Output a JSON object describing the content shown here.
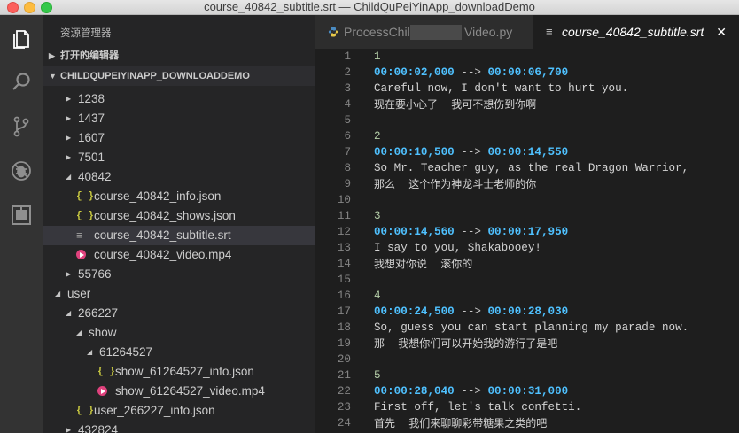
{
  "window": {
    "title": "course_40842_subtitle.srt — ChildQuPeiYinApp_downloadDemo"
  },
  "activity_bar": {
    "items": [
      "explorer",
      "search",
      "source-control",
      "debug",
      "extensions"
    ]
  },
  "sidebar": {
    "header": "资源管理器",
    "open_editors_label": "打开的编辑器",
    "project_label": "CHILDQUPEIYINAPP_DOWNLOADDEMO",
    "tree": [
      {
        "name": "1238",
        "type": "folder",
        "depth": 3,
        "expanded": false
      },
      {
        "name": "1437",
        "type": "folder",
        "depth": 3,
        "expanded": false
      },
      {
        "name": "1607",
        "type": "folder",
        "depth": 3,
        "expanded": false
      },
      {
        "name": "7501",
        "type": "folder",
        "depth": 3,
        "expanded": false
      },
      {
        "name": "40842",
        "type": "folder",
        "depth": 3,
        "expanded": true
      },
      {
        "name": "course_40842_info.json",
        "type": "json",
        "depth": 4
      },
      {
        "name": "course_40842_shows.json",
        "type": "json",
        "depth": 4
      },
      {
        "name": "course_40842_subtitle.srt",
        "type": "srt",
        "depth": 4,
        "selected": true
      },
      {
        "name": "course_40842_video.mp4",
        "type": "mp4",
        "depth": 4
      },
      {
        "name": "55766",
        "type": "folder",
        "depth": 3,
        "expanded": false
      },
      {
        "name": "user",
        "type": "folder",
        "depth": 2,
        "expanded": true
      },
      {
        "name": "266227",
        "type": "folder",
        "depth": 3,
        "expanded": true
      },
      {
        "name": "show",
        "type": "folder",
        "depth": 4,
        "expanded": true
      },
      {
        "name": "61264527",
        "type": "folder",
        "depth": 5,
        "expanded": true
      },
      {
        "name": "show_61264527_info.json",
        "type": "json",
        "depth": 6
      },
      {
        "name": "show_61264527_video.mp4",
        "type": "mp4",
        "depth": 6
      },
      {
        "name": "user_266227_info.json",
        "type": "json",
        "depth": 4
      },
      {
        "name": "432824",
        "type": "folder",
        "depth": 3,
        "expanded": false
      }
    ]
  },
  "tabs": [
    {
      "label_start": "ProcessChil",
      "label_end": "Video.py",
      "active": false
    },
    {
      "label": "course_40842_subtitle.srt",
      "active": true,
      "close": "✕"
    }
  ],
  "editor": {
    "lines": [
      {
        "n": "1",
        "kind": "num",
        "text": "1"
      },
      {
        "n": "2",
        "kind": "time",
        "start": "00:00:02,000",
        "arrow": " --> ",
        "end": "00:00:06,700"
      },
      {
        "n": "3",
        "kind": "plain",
        "text": "Careful now, I don't want to hurt you."
      },
      {
        "n": "4",
        "kind": "cn",
        "text": "现在要小心了    我可不想伤到你啊"
      },
      {
        "n": "5",
        "kind": "plain",
        "text": ""
      },
      {
        "n": "6",
        "kind": "num",
        "text": "2"
      },
      {
        "n": "7",
        "kind": "time",
        "start": "00:00:10,500",
        "arrow": " --> ",
        "end": "00:00:14,550"
      },
      {
        "n": "8",
        "kind": "plain",
        "text": "So Mr. Teacher guy, as the real Dragon Warrior,"
      },
      {
        "n": "9",
        "kind": "cn",
        "text": "那么    这个作为神龙斗士老师的你"
      },
      {
        "n": "10",
        "kind": "plain",
        "text": ""
      },
      {
        "n": "11",
        "kind": "num",
        "text": "3"
      },
      {
        "n": "12",
        "kind": "time",
        "start": "00:00:14,560",
        "arrow": " --> ",
        "end": "00:00:17,950"
      },
      {
        "n": "13",
        "kind": "plain",
        "text": "I say to you, Shakabooey!"
      },
      {
        "n": "14",
        "kind": "cn",
        "text": "我想对你说    滚你的"
      },
      {
        "n": "15",
        "kind": "plain",
        "text": ""
      },
      {
        "n": "16",
        "kind": "num",
        "text": "4"
      },
      {
        "n": "17",
        "kind": "time",
        "start": "00:00:24,500",
        "arrow": " --> ",
        "end": "00:00:28,030"
      },
      {
        "n": "18",
        "kind": "plain",
        "text": "So, guess you can start planning my parade now."
      },
      {
        "n": "19",
        "kind": "cn",
        "text": "那    我想你们可以开始我的游行了是吧"
      },
      {
        "n": "20",
        "kind": "plain",
        "text": ""
      },
      {
        "n": "21",
        "kind": "num",
        "text": "5"
      },
      {
        "n": "22",
        "kind": "time",
        "start": "00:00:28,040",
        "arrow": " --> ",
        "end": "00:00:31,000"
      },
      {
        "n": "23",
        "kind": "plain",
        "text": "First off, let's talk confetti."
      },
      {
        "n": "24",
        "kind": "cn",
        "text": "首先    我们来聊聊彩带糖果之类的吧"
      }
    ]
  },
  "colors": {
    "activity_bar": "#333333",
    "sidebar": "#252526",
    "editor": "#1e1e1e",
    "timestamp": "#4fc1ff",
    "index_number": "#b5cea8",
    "json_icon": "#cbcb41",
    "mp4_icon": "#e0427d"
  }
}
